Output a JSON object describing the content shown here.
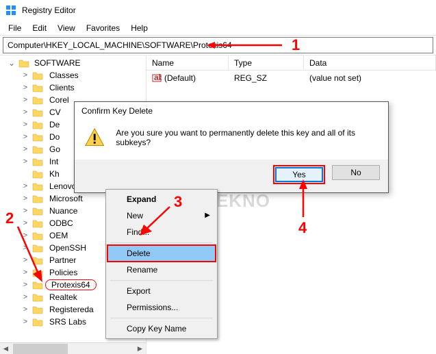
{
  "window": {
    "title": "Registry Editor"
  },
  "menu": {
    "file": "File",
    "edit": "Edit",
    "view": "View",
    "favorites": "Favorites",
    "help": "Help"
  },
  "address": {
    "path": "Computer\\HKEY_LOCAL_MACHINE\\SOFTWARE\\Protexis64"
  },
  "tree": {
    "root": "SOFTWARE",
    "items": [
      {
        "l": "Classes",
        "e": ">"
      },
      {
        "l": "Clients",
        "e": ">"
      },
      {
        "l": "Corel",
        "e": ">"
      },
      {
        "l": "CV",
        "e": ">"
      },
      {
        "l": "De",
        "e": ">"
      },
      {
        "l": "Do",
        "e": ">"
      },
      {
        "l": "Go",
        "e": ">"
      },
      {
        "l": "Int",
        "e": ">"
      },
      {
        "l": "Kh",
        "e": ""
      },
      {
        "l": "Lenovo",
        "e": ">"
      },
      {
        "l": "Microsoft",
        "e": ">"
      },
      {
        "l": "Nuance",
        "e": ">"
      },
      {
        "l": "ODBC",
        "e": ">"
      },
      {
        "l": "OEM",
        "e": ">"
      },
      {
        "l": "OpenSSH",
        "e": ">"
      },
      {
        "l": "Partner",
        "e": ">"
      },
      {
        "l": "Policies",
        "e": ">"
      },
      {
        "l": "Protexis64",
        "e": ">",
        "sel": true
      },
      {
        "l": "Realtek",
        "e": ">"
      },
      {
        "l": "Registereda",
        "e": ">"
      },
      {
        "l": "SRS Labs",
        "e": ">"
      }
    ]
  },
  "list": {
    "cols": {
      "name": "Name",
      "type": "Type",
      "data": "Data"
    },
    "rows": [
      {
        "name": "(Default)",
        "type": "REG_SZ",
        "data": "(value not set)"
      }
    ]
  },
  "dialog": {
    "title": "Confirm Key Delete",
    "msg": "Are you sure you want to permanently delete this key and all of its subkeys?",
    "yes": "Yes",
    "no": "No"
  },
  "ctx": {
    "expand": "Expand",
    "new": "New",
    "find": "Find...",
    "delete": "Delete",
    "rename": "Rename",
    "export": "Export",
    "perm": "Permissions...",
    "copy": "Copy Key Name"
  },
  "anno": {
    "n1": "1",
    "n2": "2",
    "n3": "3",
    "n4": "4"
  },
  "wm": "BAGITEKNO"
}
